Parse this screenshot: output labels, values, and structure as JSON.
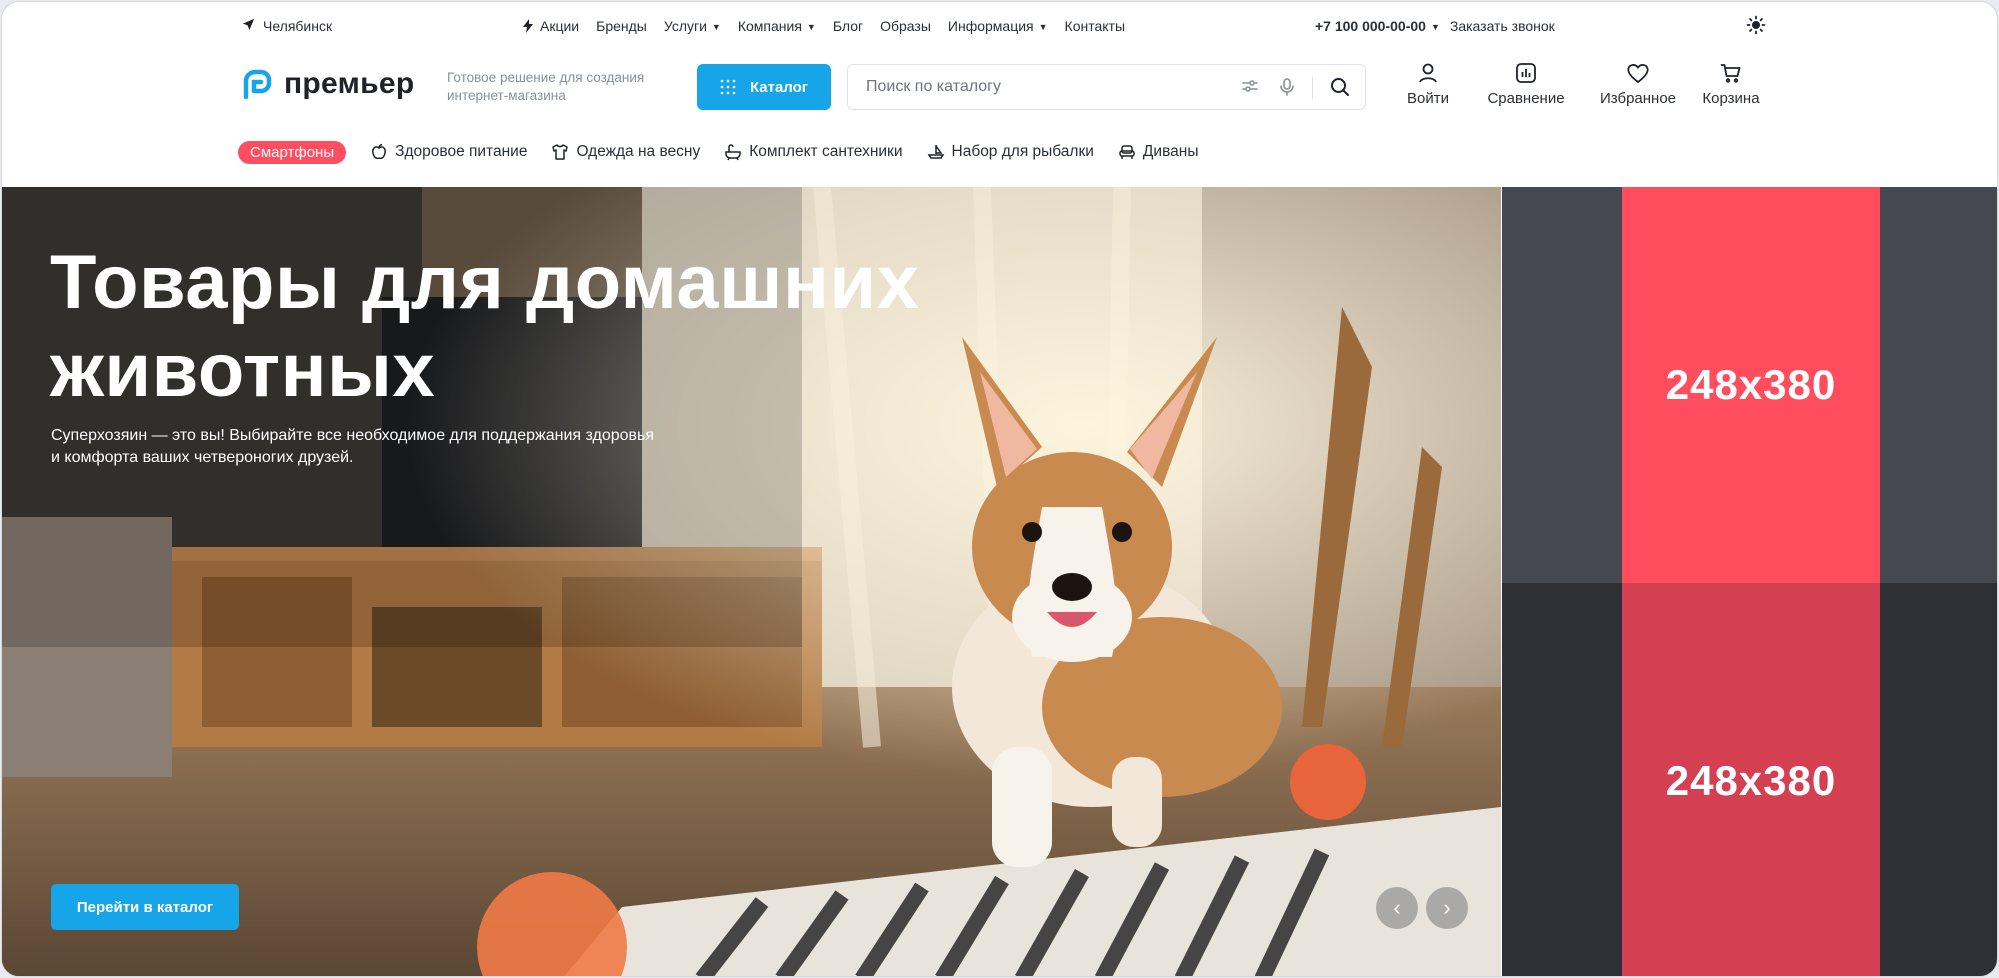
{
  "topbar": {
    "city": "Челябинск",
    "nav": [
      {
        "label": "Акции",
        "icon": "bolt-icon",
        "has_caret": false
      },
      {
        "label": "Бренды",
        "has_caret": false
      },
      {
        "label": "Услуги",
        "has_caret": true
      },
      {
        "label": "Компания",
        "has_caret": true
      },
      {
        "label": "Блог",
        "has_caret": false
      },
      {
        "label": "Образы",
        "has_caret": false
      },
      {
        "label": "Информация",
        "has_caret": true
      },
      {
        "label": "Контакты",
        "has_caret": false
      }
    ],
    "phone": "+7 100 000-00-00",
    "callback": "Заказать звонок",
    "theme_icon": "sun-icon"
  },
  "header": {
    "logo_text": "премьер",
    "tagline": "Готовое решение для создания интернет-магазина",
    "catalog_button": "Каталог",
    "search_placeholder": "Поиск по каталогу",
    "actions": [
      {
        "label": "Войти",
        "icon": "user-icon"
      },
      {
        "label": "Сравнение",
        "icon": "compare-chart-icon"
      },
      {
        "label": "Избранное",
        "icon": "heart-icon"
      },
      {
        "label": "Корзина",
        "icon": "cart-icon"
      }
    ]
  },
  "categories": {
    "highlight": "Смартфоны",
    "items": [
      {
        "label": "Здоровое питание",
        "icon": "apple-icon"
      },
      {
        "label": "Одежда на весну",
        "icon": "shirt-icon"
      },
      {
        "label": "Комплект сантехники",
        "icon": "bath-icon"
      },
      {
        "label": "Набор для рыбалки",
        "icon": "boat-icon"
      },
      {
        "label": "Диваны",
        "icon": "armchair-icon"
      }
    ]
  },
  "banner": {
    "title_line1": "Товары для домашних",
    "title_line2": "животных",
    "subtitle_line1": "Суперхозяин — это вы! Выбирайте все необходимое для поддержания здоровья",
    "subtitle_line2": "и комфорта ваших четвероногих друзей.",
    "cta": "Перейти в каталог",
    "prev": "‹",
    "next": "›"
  },
  "promos": [
    {
      "label": "248x380",
      "accent": "#ff4d5e",
      "side": "#464850"
    },
    {
      "label": "248x380",
      "accent": "#d43f52",
      "side": "#2f3036"
    }
  ],
  "colors": {
    "primary": "#17a5ea",
    "highlight": "#ff4d62"
  }
}
